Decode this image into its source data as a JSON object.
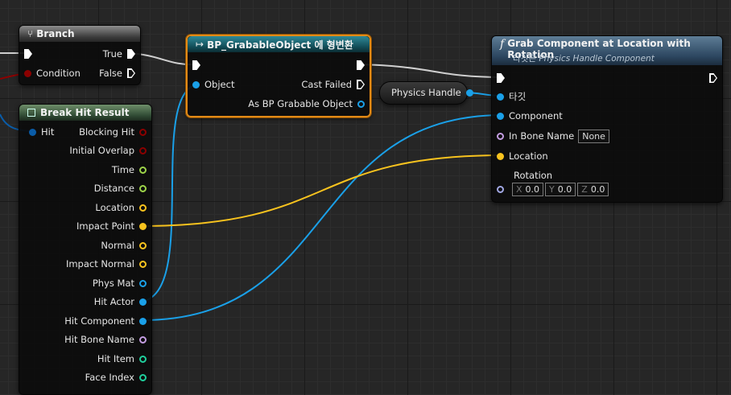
{
  "branch": {
    "title": "Branch",
    "icon": "branch-icon",
    "true_label": "True",
    "condition_label": "Condition",
    "false_label": "False"
  },
  "cast": {
    "title": "BP_GrabableObject 에 형변환",
    "icon": "cast-arrow-icon",
    "object_label": "Object",
    "cast_failed_label": "Cast Failed",
    "as_label": "As BP Grabable Object"
  },
  "physics_handle": {
    "label": "Physics Handle"
  },
  "grab": {
    "title": "Grab Component at Location with Rotation",
    "icon": "function-icon",
    "subtitle_prefix": "타깃은",
    "subtitle_target": "Physics Handle Component",
    "target_label": "타깃",
    "component_label": "Component",
    "bone_label": "In Bone Name",
    "bone_value": "None",
    "location_label": "Location",
    "rotation_label": "Rotation",
    "rot_x_label": "X",
    "rot_x": "0.0",
    "rot_y_label": "Y",
    "rot_y": "0.0",
    "rot_z_label": "Z",
    "rot_z": "0.0"
  },
  "break": {
    "title": "Break Hit Result",
    "icon": "struct-icon",
    "hit_label": "Hit",
    "outputs": [
      "Blocking Hit",
      "Initial Overlap",
      "Time",
      "Distance",
      "Location",
      "Impact Point",
      "Normal",
      "Impact Normal",
      "Phys Mat",
      "Hit Actor",
      "Hit Component",
      "Hit Bone Name",
      "Hit Item",
      "Face Index"
    ]
  },
  "colors": {
    "exec": "#ffffff",
    "boolean": "#8c0000",
    "float": "#9dd449",
    "vector": "#f8c31e",
    "object": "#1aa0e8",
    "name": "#c49de2",
    "integer": "#1fcf9c",
    "rotator": "#a2a8e4",
    "struct": "#0a5ca8",
    "selection": "#e28a16"
  }
}
